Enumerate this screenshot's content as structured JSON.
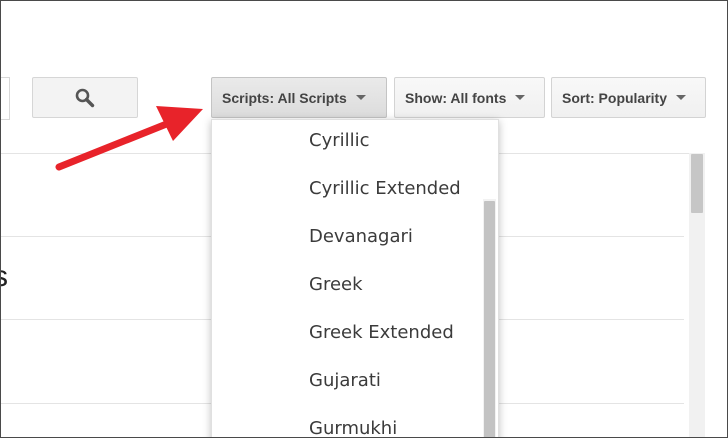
{
  "toolbar": {
    "scripts_label": "Scripts: All Scripts",
    "show_label": "Show: All fonts",
    "sort_label": "Sort: Popularity"
  },
  "background": {
    "partial_letter": "s"
  },
  "dropdown": {
    "items": [
      {
        "label": "Cyrillic"
      },
      {
        "label": "Cyrillic Extended"
      },
      {
        "label": "Devanagari"
      },
      {
        "label": "Greek"
      },
      {
        "label": "Greek Extended"
      },
      {
        "label": "Gujarati"
      },
      {
        "label": "Gurmukhi"
      }
    ]
  },
  "icons": {
    "search": "search-icon",
    "arrow": "red-arrow-annotation"
  },
  "colors": {
    "arrow": "#e8232a",
    "button_bg": "#f3f3f3",
    "active_button_bg": "#e2e2e2"
  }
}
